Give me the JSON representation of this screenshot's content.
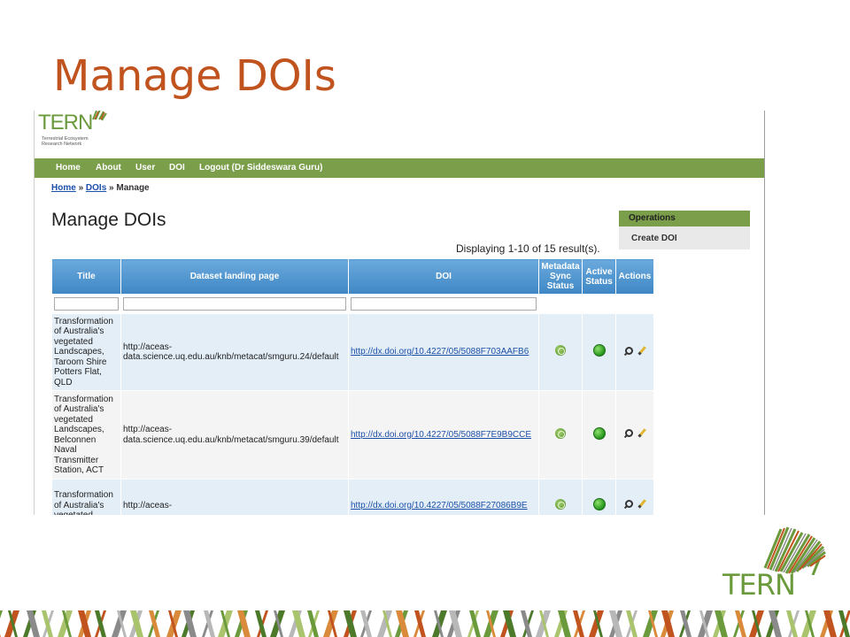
{
  "slide": {
    "title": "Manage DOIs"
  },
  "site": {
    "logo_text": "TERN",
    "logo_subtitle_line1": "Terrestrial Ecosystem",
    "logo_subtitle_line2": "Research Network",
    "nav": [
      "Home",
      "About",
      "User",
      "DOI",
      "Logout (Dr Siddeswara Guru)"
    ],
    "breadcrumb": {
      "home": "Home",
      "sep1": " » ",
      "dois": "DOIs",
      "sep2": " » ",
      "current": "Manage"
    },
    "page_heading": "Manage DOIs",
    "operations": {
      "header": "Operations",
      "create": "Create DOI"
    },
    "result_summary": "Displaying 1-10 of 15 result(s).",
    "table": {
      "columns": [
        "Title",
        "Dataset landing page",
        "DOI",
        "Metadata Sync Status",
        "Active Status",
        "Actions"
      ],
      "rows": [
        {
          "title": "Transformation of Australia's vegetated Landscapes, Taroom Shire Potters Flat, QLD",
          "landing": "http://aceas-data.science.uq.edu.au/knb/metacat/smguru.24/default",
          "doi": "http://dx.doi.org/10.4227/05/5088F703AAFB6"
        },
        {
          "title": "Transformation of Australia's vegetated Landscapes, Belconnen Naval Transmitter Station, ACT",
          "landing": "http://aceas-data.science.uq.edu.au/knb/metacat/smguru.39/default",
          "doi": "http://dx.doi.org/10.4227/05/5088F7E9B9CCE"
        },
        {
          "title": "Transformation of Australia's vegetated",
          "landing": "http://aceas-",
          "doi": "http://dx.doi.org/10.4227/05/5088F27086B9E"
        }
      ]
    }
  },
  "brand": {
    "logo_text": "TERN"
  },
  "colors": {
    "title": "#c0531e",
    "nav": "#7a9e4a",
    "table_header": "#4a90cc",
    "link": "#1c50a8"
  }
}
